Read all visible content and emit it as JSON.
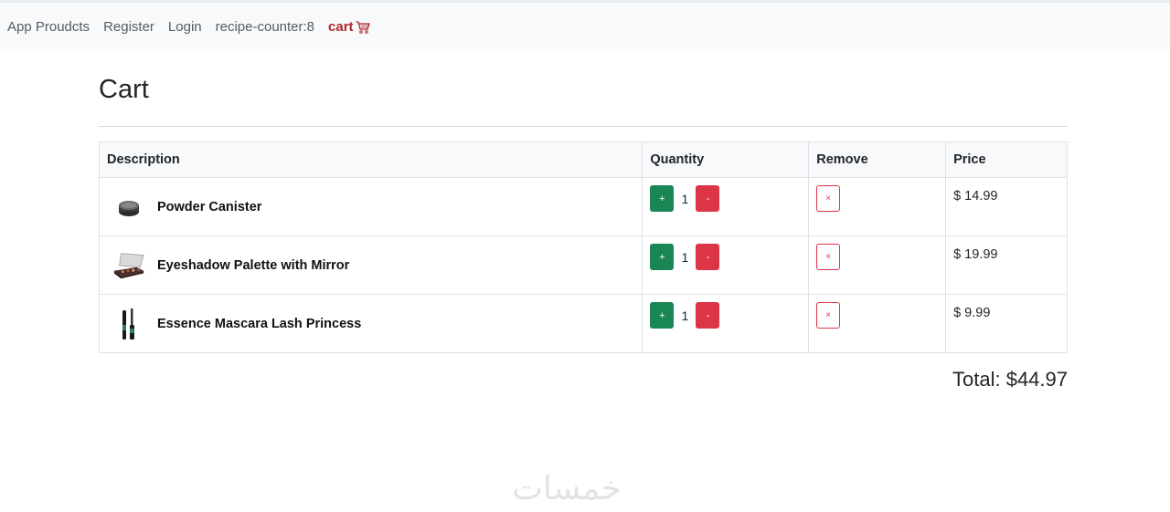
{
  "nav": {
    "items": [
      "App Proudcts",
      "Register",
      "Login",
      "recipe-counter:8"
    ],
    "cart_label": "cart",
    "cart_color": "#b0262b"
  },
  "page": {
    "title": "Cart"
  },
  "table": {
    "headers": [
      "Description",
      "Quantity",
      "Remove",
      "Price"
    ],
    "rows": [
      {
        "name": "Powder Canister",
        "qty": "1",
        "price": "$ 14.99",
        "thumb": "powder-canister-image"
      },
      {
        "name": "Eyeshadow Palette with Mirror",
        "qty": "1",
        "price": "$ 19.99",
        "thumb": "eyeshadow-palette-image"
      },
      {
        "name": "Essence Mascara Lash Princess",
        "qty": "1",
        "price": "$ 9.99",
        "thumb": "mascara-image"
      }
    ],
    "plus_label": "+",
    "minus_label": "-",
    "remove_label": "×"
  },
  "total": {
    "label": "Total: $44.97"
  },
  "watermark": "خمسات",
  "colors": {
    "success": "#198754",
    "danger": "#dc3545"
  }
}
